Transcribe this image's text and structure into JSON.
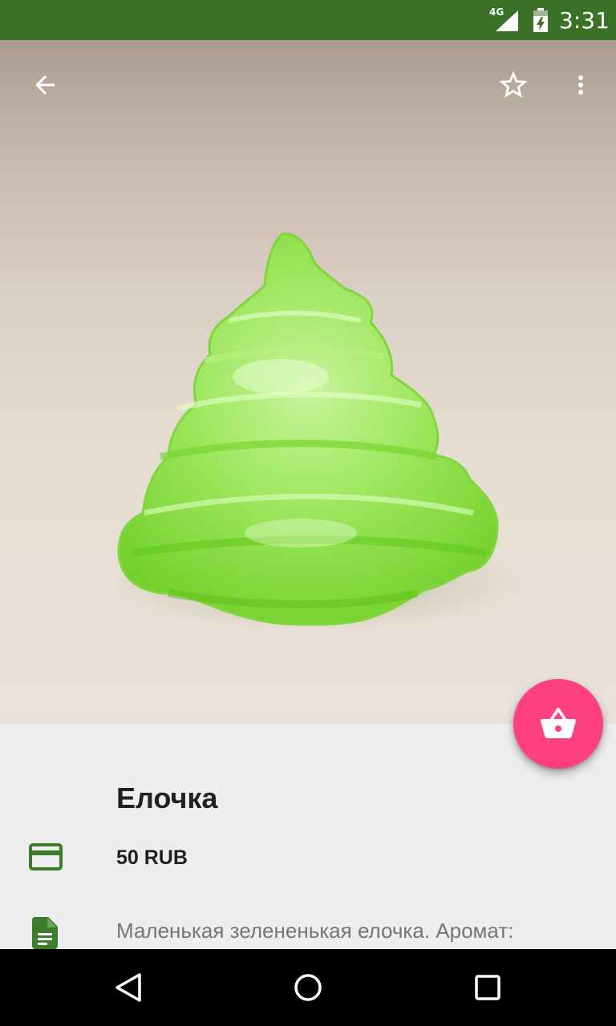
{
  "status_bar": {
    "network": "4G",
    "time": "3:31"
  },
  "toolbar": {
    "back_icon": "arrow-back-icon",
    "favorite_icon": "star-outline-icon",
    "more_icon": "more-vert-icon"
  },
  "fab": {
    "icon": "shopping-basket-icon",
    "color": "#ff4081"
  },
  "product": {
    "name": "Елочка",
    "price": "50 RUB",
    "description": "Маленькая зелененькая елочка. Аромат:"
  },
  "colors": {
    "status_bar": "#3b7126",
    "icon_accent": "#3b7d2a",
    "fab": "#ff4081"
  },
  "nav_bar": {
    "back_icon": "nav-back-icon",
    "home_icon": "nav-home-icon",
    "recents_icon": "nav-recents-icon"
  }
}
